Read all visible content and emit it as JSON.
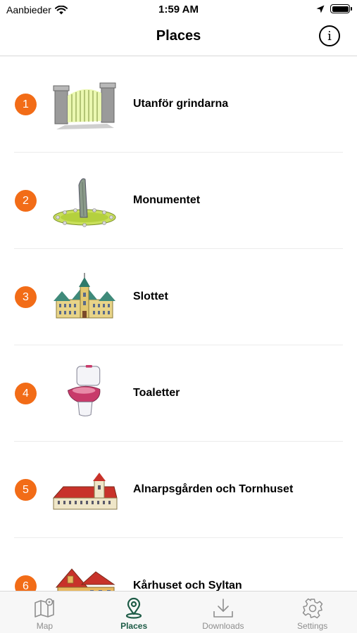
{
  "status_bar": {
    "carrier": "Aanbieder",
    "time": "1:59 AM"
  },
  "nav": {
    "title": "Places",
    "info_icon": "info-icon"
  },
  "places": [
    {
      "number": "1",
      "name": "Utanför grindarna",
      "thumbnail": "gate-illustration"
    },
    {
      "number": "2",
      "name": "Monumentet",
      "thumbnail": "monument-illustration"
    },
    {
      "number": "3",
      "name": "Slottet",
      "thumbnail": "castle-illustration"
    },
    {
      "number": "4",
      "name": "Toaletter",
      "thumbnail": "toilet-illustration"
    },
    {
      "number": "5",
      "name": "Alnarpsgården och Tornhuset",
      "thumbnail": "farmhouse-illustration"
    },
    {
      "number": "6",
      "name": "Kårhuset och Syltan",
      "thumbnail": "student-house-illustration"
    }
  ],
  "tabs": [
    {
      "label": "Map",
      "icon": "map-icon",
      "active": false
    },
    {
      "label": "Places",
      "icon": "location-pin-icon",
      "active": true
    },
    {
      "label": "Downloads",
      "icon": "download-icon",
      "active": false
    },
    {
      "label": "Settings",
      "icon": "gear-icon",
      "active": false
    }
  ],
  "colors": {
    "badge": "#f26c17",
    "active_tab": "#1d5b46",
    "inactive_tab": "#8e8e8e"
  }
}
